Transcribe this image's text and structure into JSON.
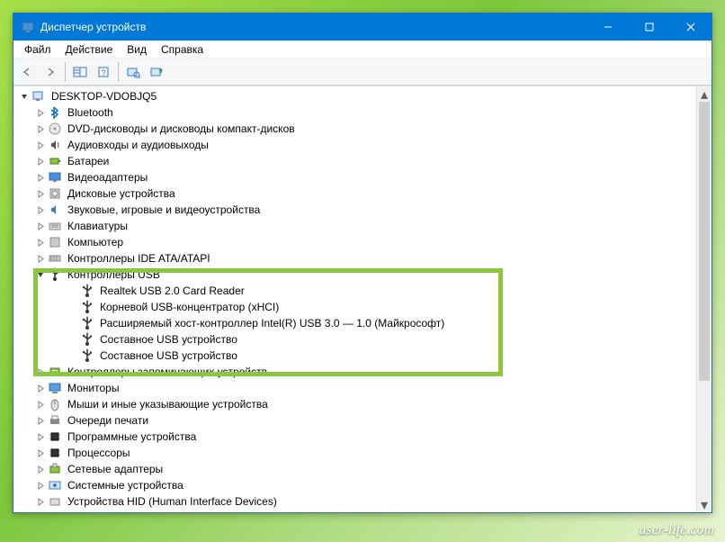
{
  "window": {
    "title": "Диспетчер устройств"
  },
  "menubar": {
    "file": "Файл",
    "action": "Действие",
    "view": "Вид",
    "help": "Справка"
  },
  "tree": {
    "root": "DESKTOP-VDOBJQ5",
    "categories": [
      {
        "label": "Bluetooth",
        "icon": "bt"
      },
      {
        "label": "DVD-дисководы и дисководы компакт-дисков",
        "icon": "disc"
      },
      {
        "label": "Аудиовходы и аудиовыходы",
        "icon": "audio"
      },
      {
        "label": "Батареи",
        "icon": "battery"
      },
      {
        "label": "Видеоадаптеры",
        "icon": "display"
      },
      {
        "label": "Дисковые устройства",
        "icon": "hdd"
      },
      {
        "label": "Звуковые, игровые и видеоустройства",
        "icon": "sound"
      },
      {
        "label": "Клавиатуры",
        "icon": "keyboard"
      },
      {
        "label": "Компьютер",
        "icon": "pc"
      },
      {
        "label": "Контроллеры IDE ATA/ATAPI",
        "icon": "ide",
        "partial": true
      },
      {
        "label": "Контроллеры USB",
        "icon": "usb",
        "expanded": true,
        "children": [
          "Realtek USB 2.0 Card Reader",
          "Корневой USB-концентратор (xHCI)",
          "Расширяемый хост-контроллер Intel(R) USB 3.0 — 1.0 (Майкрософт)",
          "Составное USB устройство",
          "Составное USB устройство"
        ]
      },
      {
        "label": "Контроллеры запоминающих устройств",
        "icon": "storage"
      },
      {
        "label": "Мониторы",
        "icon": "monitor"
      },
      {
        "label": "Мыши и иные указывающие устройства",
        "icon": "mouse"
      },
      {
        "label": "Очереди печати",
        "icon": "printer"
      },
      {
        "label": "Программные устройства",
        "icon": "chip"
      },
      {
        "label": "Процессоры",
        "icon": "cpu"
      },
      {
        "label": "Сетевые адаптеры",
        "icon": "net"
      },
      {
        "label": "Системные устройства",
        "icon": "sys"
      },
      {
        "label": "Устройства HID (Human Interface Devices)",
        "icon": "hid",
        "partial": true
      }
    ]
  },
  "watermark": "user-life.com"
}
